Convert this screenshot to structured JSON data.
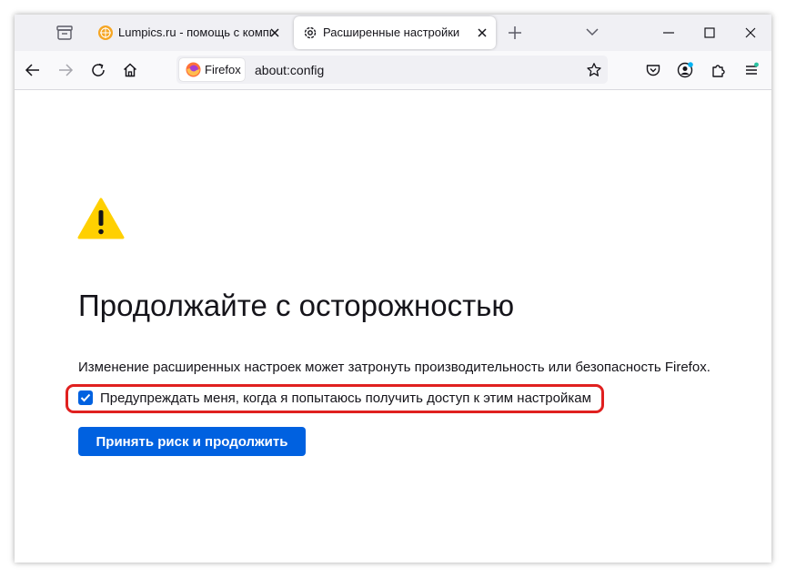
{
  "tabs": [
    {
      "title": "Lumpics.ru - помощь с компьютером",
      "favicon": "orange-favicon",
      "active": false
    },
    {
      "title": "Расширенные настройки",
      "favicon": "gear-icon",
      "active": true
    }
  ],
  "toolbar": {
    "identity_label": "Firefox",
    "url": "about:config"
  },
  "content": {
    "heading": "Продолжайте с осторожностью",
    "description": "Изменение расширенных настроек может затронуть производительность или безопасность Firefox.",
    "checkbox_label": "Предупреждать меня, когда я попытаюсь получить доступ к этим настройкам",
    "checkbox_checked": true,
    "accept_button": "Принять риск и продолжить"
  },
  "colors": {
    "accent": "#0061e0",
    "warning": "#ffd000",
    "highlight": "#e0201f"
  }
}
